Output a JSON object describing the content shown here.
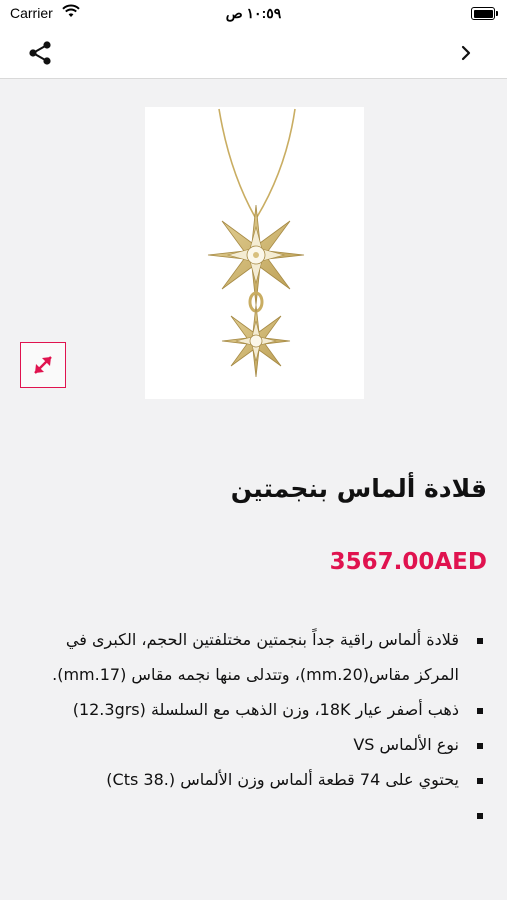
{
  "status_bar": {
    "carrier": "Carrier",
    "time": "١٠:٥٩ ص"
  },
  "product": {
    "title": "قلادة ألماس بنجمتين",
    "price": "3567.00AED",
    "image_icon": "star-pendant-necklace",
    "description": [
      "قلادة ألماس راقية جداً بنجمتين مختلفتين الحجم، الكبرى في المركز مقاس(mm.20)، وتتدلى منها نجمه مقاس (mm.17).",
      "ذهب أصفر عيار 18K، وزن الذهب مع السلسلة (12.3grs)",
      "نوع الألماس VS",
      "يحتوي على 74 قطعة ألماس وزن الألماس (.38 Cts)",
      ""
    ]
  },
  "colors": {
    "accent": "#e0134f",
    "background": "#f2f2f3"
  },
  "icons": {
    "share": "share-icon",
    "back": "chevron-right-icon",
    "expand": "expand-icon"
  }
}
